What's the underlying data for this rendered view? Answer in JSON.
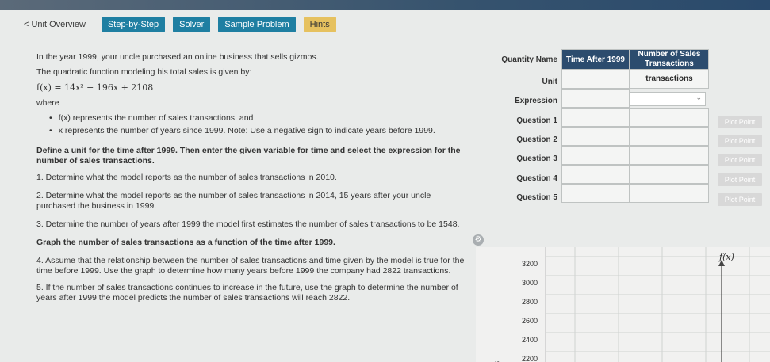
{
  "nav": {
    "back_label": "< Unit Overview",
    "tabs": [
      "Step-by-Step",
      "Solver",
      "Sample Problem",
      "Hints"
    ]
  },
  "problem": {
    "intro1": "In the year 1999, your uncle purchased an online business that sells gizmos.",
    "intro2": "The quadratic function modeling his total sales is given by:",
    "formula": "f(x) = 14x² − 196x + 2108",
    "where": "where",
    "bullet1": "f(x) represents the number of sales transactions, and",
    "bullet2": "x represents the number of years since 1999. Note: Use a negative sign to indicate years before 1999.",
    "define": "Define a unit for the time after 1999. Then enter the given variable for time and select the expression for the number of sales transactions.",
    "q1": "1. Determine what the model reports as the number of sales transactions in 2010.",
    "q2": "2. Determine what the model reports as the number of sales transactions in 2014, 15 years after your uncle purchased the business in 1999.",
    "q3": "3. Determine the number of years after 1999 the model first estimates the number of sales transactions to be 1548.",
    "graph_head": "Graph the number of sales transactions as a function of the time after 1999.",
    "q4": "4. Assume that the relationship between the number of sales transactions and time given by the model is true for the time before 1999. Use the graph to determine how many years before 1999 the company had 2822 transactions.",
    "q5": "5. If the number of sales transactions continues to increase in the future, use the graph to determine the number of years after 1999 the model predicts the number of sales transactions will reach 2822."
  },
  "table": {
    "row_labels": [
      "Quantity Name",
      "Unit",
      "Expression",
      "Question 1",
      "Question 2",
      "Question 3",
      "Question 4",
      "Question 5"
    ],
    "col_headers": [
      "Time After 1999",
      "Number of Sales Transactions"
    ],
    "unit_value": "transactions",
    "plot_label": "Plot Point"
  },
  "graph": {
    "y_label": "f(x)",
    "y_ticks": [
      "3200",
      "3000",
      "2800",
      "2600",
      "2400",
      "2200"
    ],
    "side_label": "S"
  },
  "colors": {
    "header": "#2c4c6e",
    "tab": "#1f7fa2",
    "hints": "#e6c15f"
  }
}
